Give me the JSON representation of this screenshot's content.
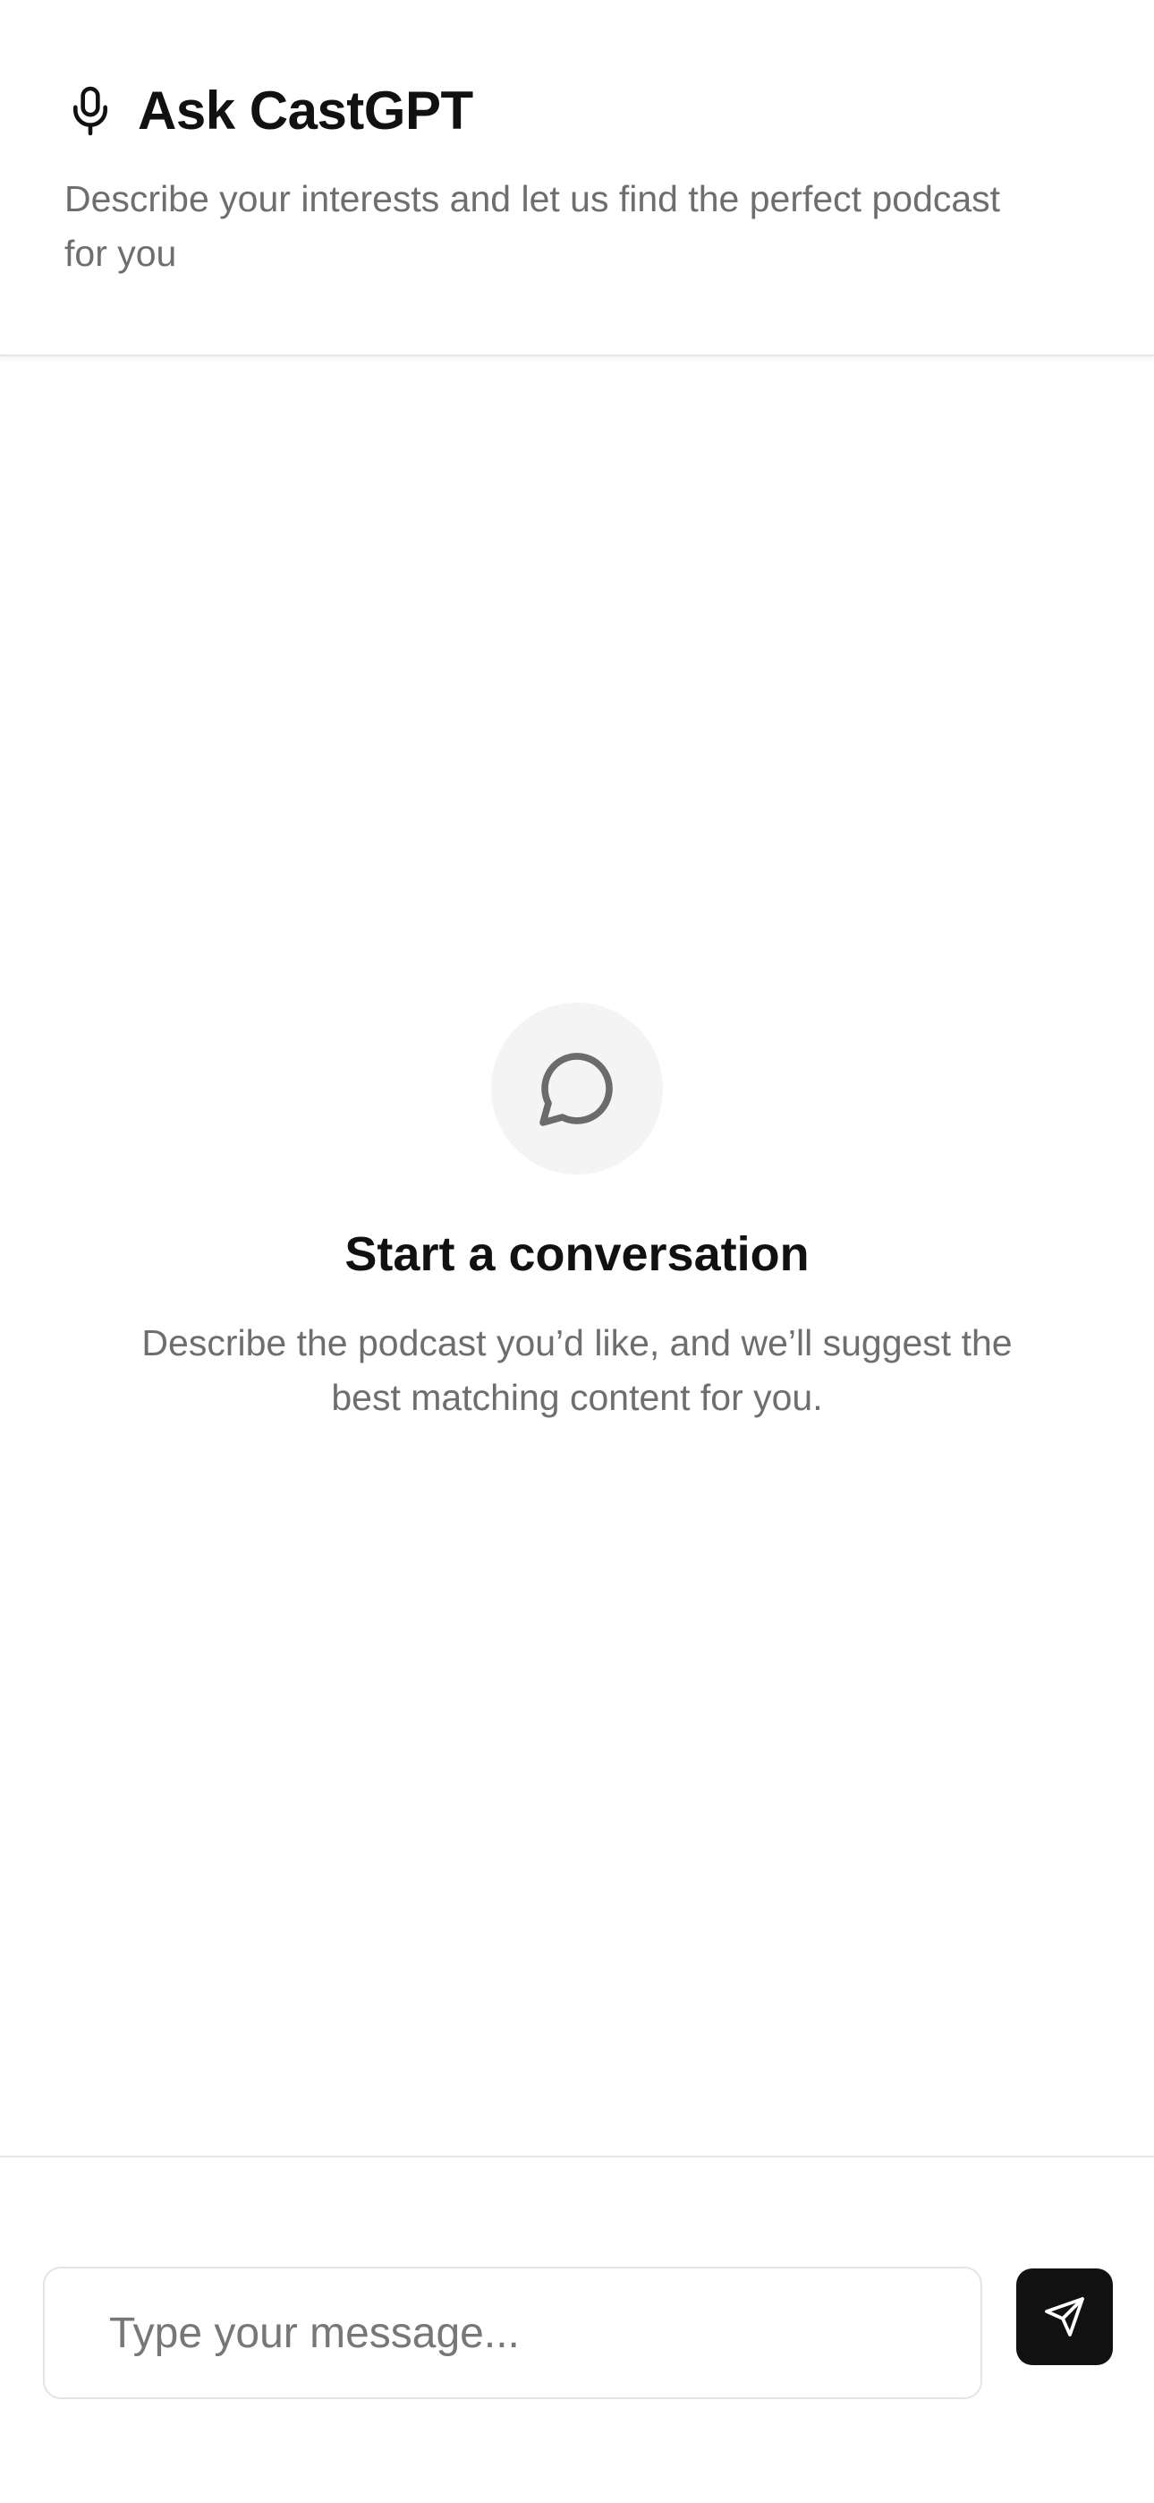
{
  "header": {
    "title": "Ask CastGPT",
    "subtitle": "Describe your interests and let us find the perfect podcast for you",
    "icon": "microphone-icon"
  },
  "empty_state": {
    "icon": "message-circle-icon",
    "title": "Start a conversation",
    "description": "Describe the podcast you’d like, and we’ll suggest the best matching content for you."
  },
  "composer": {
    "placeholder": "Type your message...",
    "value": "",
    "send_icon": "send-icon"
  },
  "colors": {
    "text_primary": "#111111",
    "text_muted": "#6e6e6e",
    "icon_circle_bg": "#f4f4f4",
    "send_button_bg": "#111111",
    "border": "#e7e7e7"
  }
}
